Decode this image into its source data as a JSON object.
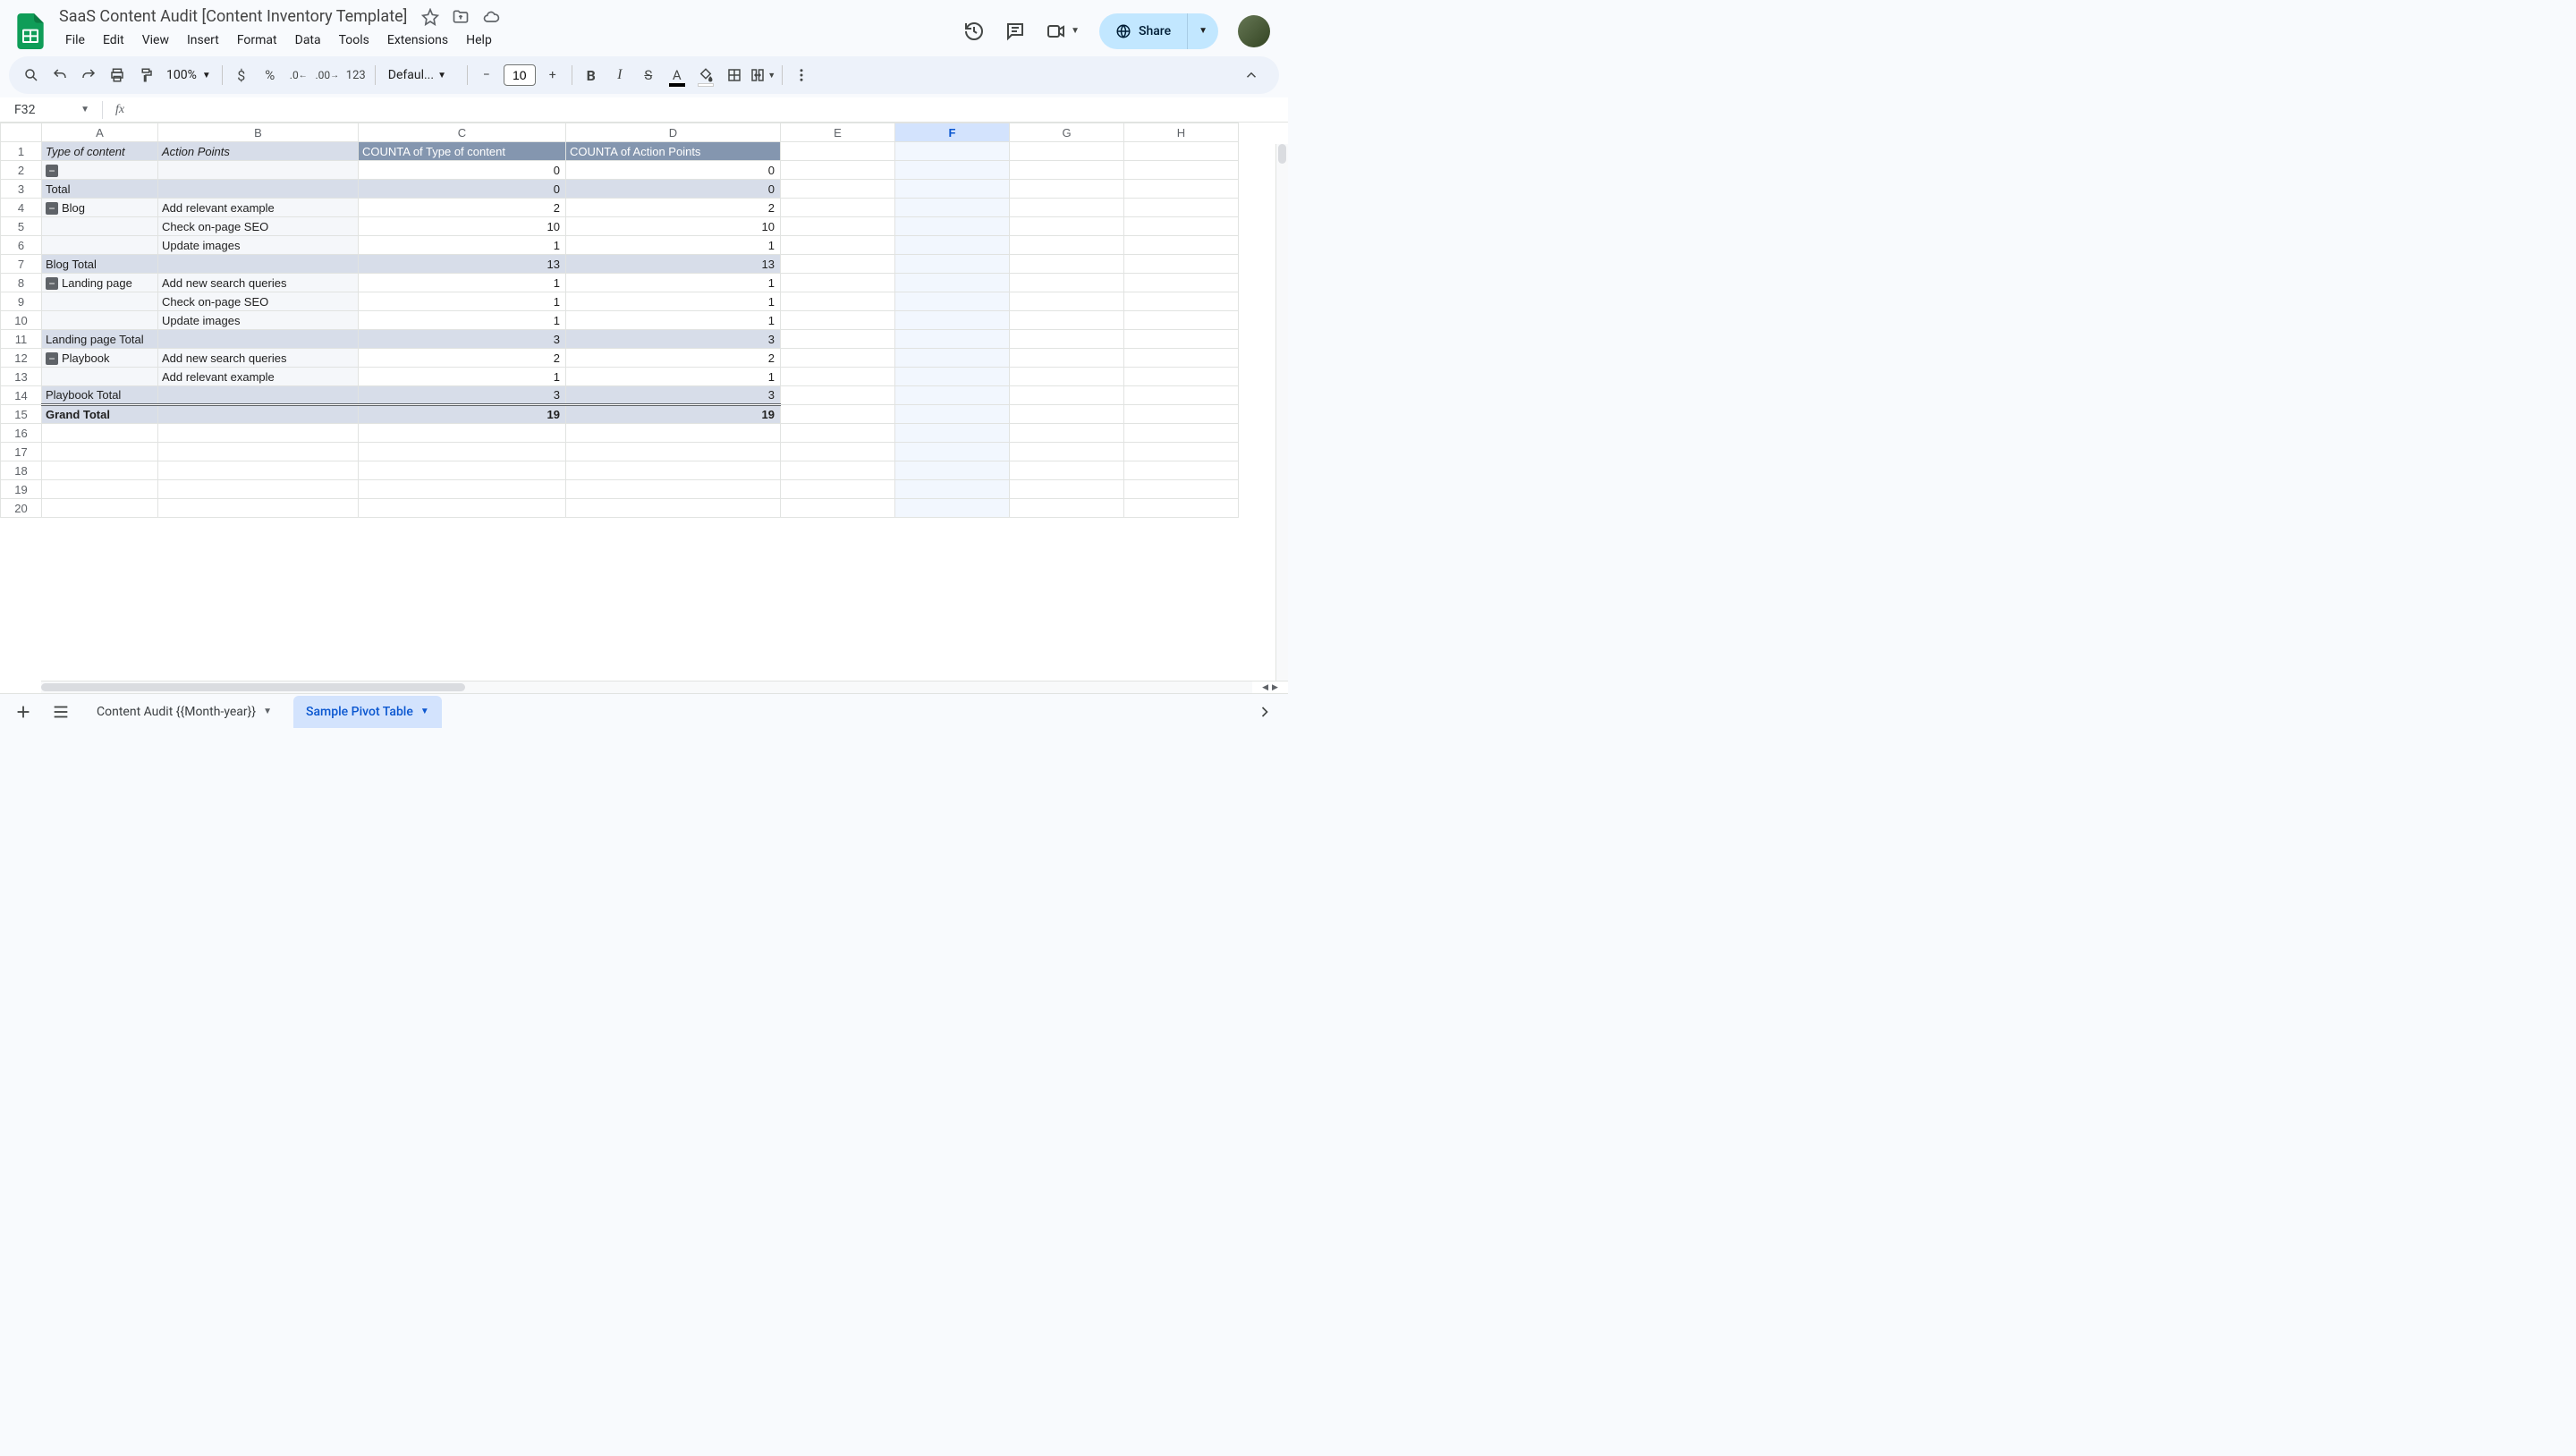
{
  "doc": {
    "title": "SaaS Content Audit [Content Inventory Template]"
  },
  "menu": {
    "file": "File",
    "edit": "Edit",
    "view": "View",
    "insert": "Insert",
    "format": "Format",
    "data": "Data",
    "tools": "Tools",
    "extensions": "Extensions",
    "help": "Help"
  },
  "toolbar": {
    "zoom": "100%",
    "font": "Defaul...",
    "size": "10"
  },
  "share": {
    "label": "Share"
  },
  "namebox": {
    "ref": "F32"
  },
  "columns": [
    "A",
    "B",
    "C",
    "D",
    "E",
    "F",
    "G",
    "H"
  ],
  "selected_col": "F",
  "rows_visible": 20,
  "headers": {
    "A": "Type of content",
    "B": "Action Points",
    "C": "COUNTA of Type of content",
    "D": "COUNTA of Action Points"
  },
  "pivot_rows": [
    {
      "r": 2,
      "type": "group",
      "collapse": true,
      "A": "",
      "B": "",
      "C": "0",
      "D": "0",
      "bg": "data"
    },
    {
      "r": 3,
      "type": "subtotal",
      "A": "Total",
      "C": "0",
      "D": "0"
    },
    {
      "r": 4,
      "type": "group",
      "collapse": true,
      "A": "Blog",
      "B": "Add relevant example",
      "C": "2",
      "D": "2",
      "bg": "data"
    },
    {
      "r": 5,
      "type": "data",
      "B": "Check on-page SEO",
      "C": "10",
      "D": "10"
    },
    {
      "r": 6,
      "type": "data",
      "B": "Update images",
      "C": "1",
      "D": "1"
    },
    {
      "r": 7,
      "type": "subtotal",
      "A": "Blog  Total",
      "C": "13",
      "D": "13"
    },
    {
      "r": 8,
      "type": "group",
      "collapse": true,
      "A": "Landing page",
      "B": "Add new search queries",
      "C": "1",
      "D": "1",
      "bg": "data"
    },
    {
      "r": 9,
      "type": "data",
      "B": "Check on-page SEO",
      "C": "1",
      "D": "1"
    },
    {
      "r": 10,
      "type": "data",
      "B": "Update images",
      "C": "1",
      "D": "1"
    },
    {
      "r": 11,
      "type": "subtotal",
      "A": "Landing page  Total",
      "C": "3",
      "D": "3"
    },
    {
      "r": 12,
      "type": "group",
      "collapse": true,
      "A": "Playbook",
      "B": "Add new search queries",
      "C": "2",
      "D": "2",
      "bg": "data"
    },
    {
      "r": 13,
      "type": "data",
      "B": "Add relevant example",
      "C": "1",
      "D": "1"
    },
    {
      "r": 14,
      "type": "subtotal",
      "A": "Playbook  Total",
      "C": "3",
      "D": "3"
    },
    {
      "r": 15,
      "type": "grand",
      "A": "Grand Total",
      "C": "19",
      "D": "19"
    }
  ],
  "sheets": {
    "tab1": "Content Audit {{Month-year}}",
    "tab2": "Sample Pivot Table",
    "active": "tab2"
  },
  "chart_data": {
    "type": "table",
    "title": "Pivot table: count of content types and action points",
    "columns": [
      "Type of content",
      "Action Points",
      "COUNTA of Type of content",
      "COUNTA of Action Points"
    ],
    "rows": [
      [
        "",
        "",
        0,
        0
      ],
      [
        "Total",
        "",
        0,
        0
      ],
      [
        "Blog",
        "Add relevant example",
        2,
        2
      ],
      [
        "Blog",
        "Check on-page SEO",
        10,
        10
      ],
      [
        "Blog",
        "Update images",
        1,
        1
      ],
      [
        "Blog Total",
        "",
        13,
        13
      ],
      [
        "Landing page",
        "Add new search queries",
        1,
        1
      ],
      [
        "Landing page",
        "Check on-page SEO",
        1,
        1
      ],
      [
        "Landing page",
        "Update images",
        1,
        1
      ],
      [
        "Landing page Total",
        "",
        3,
        3
      ],
      [
        "Playbook",
        "Add new search queries",
        2,
        2
      ],
      [
        "Playbook",
        "Add relevant example",
        1,
        1
      ],
      [
        "Playbook Total",
        "",
        3,
        3
      ],
      [
        "Grand Total",
        "",
        19,
        19
      ]
    ]
  }
}
